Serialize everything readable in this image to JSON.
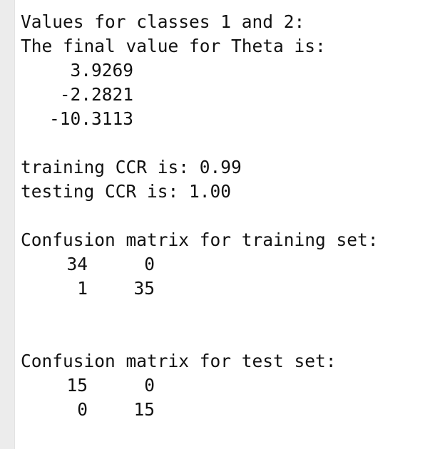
{
  "console": {
    "heading": "Values for classes 1 and 2:",
    "theta_label": "The final value for Theta is:",
    "theta_values": [
      "3.9269",
      "-2.2821",
      "-10.3113"
    ],
    "training_ccr": "training CCR is: 0.99",
    "testing_ccr": "testing CCR is: 1.00",
    "train_matrix_label": "Confusion matrix for training set:",
    "train_matrix": [
      [
        "34",
        "0"
      ],
      [
        "1",
        "35"
      ]
    ],
    "test_matrix_label": "Confusion matrix for test set:",
    "test_matrix": [
      [
        "15",
        "0"
      ],
      [
        "0",
        "15"
      ]
    ]
  }
}
